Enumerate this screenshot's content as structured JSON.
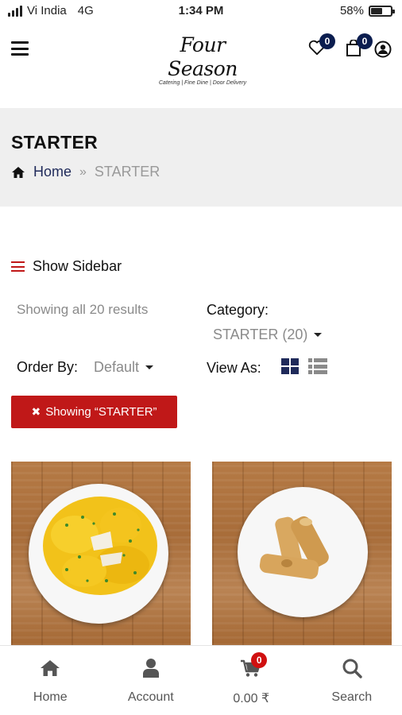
{
  "status_bar": {
    "carrier": "Vi India",
    "network": "4G",
    "time": "1:34 PM",
    "battery": "58%",
    "battery_level": 0.58
  },
  "header": {
    "logo_text": "Four Season",
    "logo_tagline": "Catering | Fine Dine | Door Delivery",
    "wishlist_count": "0",
    "cart_count": "0"
  },
  "title_band": {
    "title": "STARTER",
    "breadcrumb": {
      "home": "Home",
      "separator": "»",
      "current": "STARTER"
    }
  },
  "toolbar": {
    "show_sidebar": "Show Sidebar",
    "results_text": "Showing all 20 results",
    "category_label": "Category:",
    "category_value": "STARTER (20)",
    "order_label": "Order By:",
    "order_value": "Default",
    "view_label": "View As:",
    "filter_chip": "Showing “STARTER”"
  },
  "products": [
    {
      "image_desc": "starter-dish-1"
    },
    {
      "image_desc": "starter-dish-2"
    }
  ],
  "bottom_nav": {
    "items": [
      {
        "label": "Home",
        "icon": "home-icon"
      },
      {
        "label": "Account",
        "icon": "user-icon"
      },
      {
        "label": "0.00 ₹",
        "icon": "cart-icon",
        "badge": "0"
      },
      {
        "label": "Search",
        "icon": "search-icon"
      }
    ]
  },
  "colors": {
    "accent_red": "#c01818",
    "navy": "#1f2a5a",
    "badge_navy": "#0b1d4f",
    "band_gray": "#efefef"
  }
}
